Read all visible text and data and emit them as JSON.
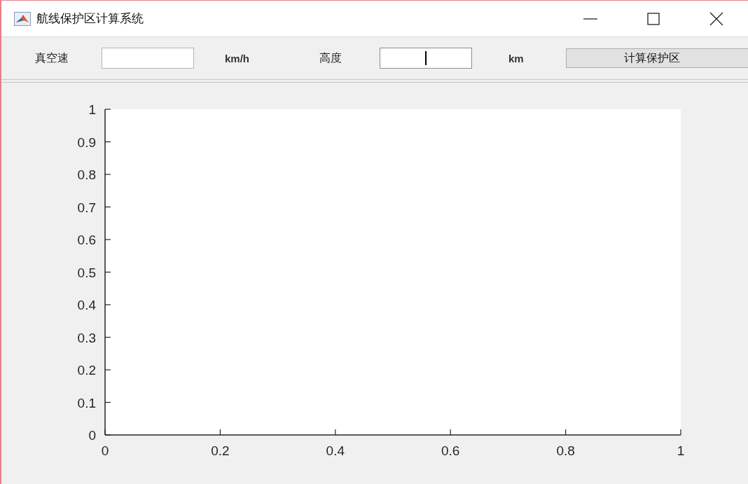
{
  "window": {
    "title": "航线保护区计算系统"
  },
  "toolbar": {
    "fields": [
      {
        "label": "真空速",
        "unit": "km/h",
        "focused": false
      },
      {
        "label": "高度",
        "unit": "km",
        "focused": true
      }
    ],
    "button": "计算保护区"
  },
  "plot": {
    "chart_data": {
      "type": "line",
      "xlim": [
        0,
        1
      ],
      "ylim": [
        0,
        1
      ],
      "xticks": [
        {
          "value": 0,
          "label": "0"
        },
        {
          "value": 0.2,
          "label": "0.2"
        },
        {
          "value": 0.4,
          "label": "0.4"
        },
        {
          "value": 0.6,
          "label": "0.6"
        },
        {
          "value": 0.8,
          "label": "0.8"
        },
        {
          "value": 1,
          "label": "1"
        }
      ],
      "yticks": [
        {
          "value": 0,
          "label": "0"
        },
        {
          "value": 0.1,
          "label": "0.1"
        },
        {
          "value": 0.2,
          "label": "0.2"
        },
        {
          "value": 0.3,
          "label": "0.3"
        },
        {
          "value": 0.4,
          "label": "0.4"
        },
        {
          "value": 0.5,
          "label": "0.5"
        },
        {
          "value": 0.6,
          "label": "0.6"
        },
        {
          "value": 0.7,
          "label": "0.7"
        },
        {
          "value": 0.8,
          "label": "0.8"
        },
        {
          "value": 0.9,
          "label": "0.9"
        },
        {
          "value": 1,
          "label": "1"
        }
      ]
    }
  }
}
